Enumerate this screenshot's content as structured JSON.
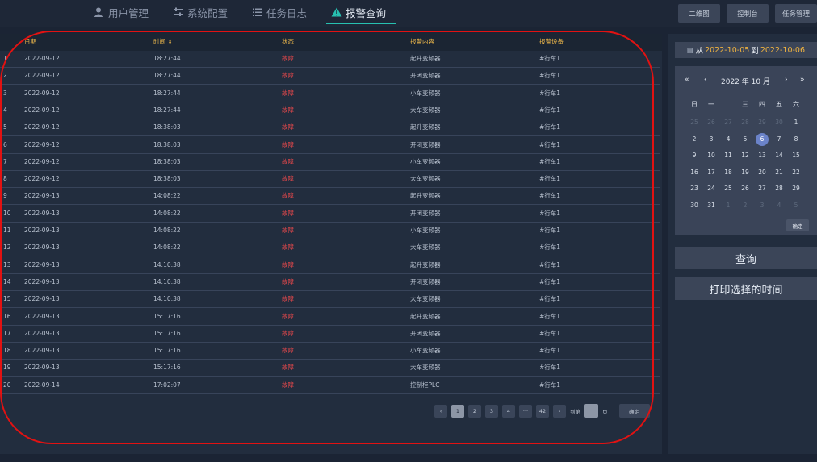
{
  "nav": {
    "items": [
      {
        "label": "用户管理",
        "icon": "user-icon"
      },
      {
        "label": "系统配置",
        "icon": "sliders-icon"
      },
      {
        "label": "任务日志",
        "icon": "list-icon"
      },
      {
        "label": "报警查询",
        "icon": "warning-icon"
      }
    ],
    "active": "报警查询"
  },
  "top_buttons": [
    "二维图",
    "控制台",
    "任务管理"
  ],
  "table": {
    "headers": [
      "日期",
      "时间 ⇕",
      "状态",
      "报警内容",
      "报警设备"
    ],
    "rows": [
      [
        "1",
        "2022-09-12",
        "18:27:44",
        "故障",
        "起升变频器",
        "#行车1"
      ],
      [
        "2",
        "2022-09-12",
        "18:27:44",
        "故障",
        "开闭变频器",
        "#行车1"
      ],
      [
        "3",
        "2022-09-12",
        "18:27:44",
        "故障",
        "小车变频器",
        "#行车1"
      ],
      [
        "4",
        "2022-09-12",
        "18:27:44",
        "故障",
        "大车变频器",
        "#行车1"
      ],
      [
        "5",
        "2022-09-12",
        "18:38:03",
        "故障",
        "起升变频器",
        "#行车1"
      ],
      [
        "6",
        "2022-09-12",
        "18:38:03",
        "故障",
        "开闭变频器",
        "#行车1"
      ],
      [
        "7",
        "2022-09-12",
        "18:38:03",
        "故障",
        "小车变频器",
        "#行车1"
      ],
      [
        "8",
        "2022-09-12",
        "18:38:03",
        "故障",
        "大车变频器",
        "#行车1"
      ],
      [
        "9",
        "2022-09-13",
        "14:08:22",
        "故障",
        "起升变频器",
        "#行车1"
      ],
      [
        "10",
        "2022-09-13",
        "14:08:22",
        "故障",
        "开闭变频器",
        "#行车1"
      ],
      [
        "11",
        "2022-09-13",
        "14:08:22",
        "故障",
        "小车变频器",
        "#行车1"
      ],
      [
        "12",
        "2022-09-13",
        "14:08:22",
        "故障",
        "大车变频器",
        "#行车1"
      ],
      [
        "13",
        "2022-09-13",
        "14:10:38",
        "故障",
        "起升变频器",
        "#行车1"
      ],
      [
        "14",
        "2022-09-13",
        "14:10:38",
        "故障",
        "开闭变频器",
        "#行车1"
      ],
      [
        "15",
        "2022-09-13",
        "14:10:38",
        "故障",
        "大车变频器",
        "#行车1"
      ],
      [
        "16",
        "2022-09-13",
        "15:17:16",
        "故障",
        "起升变频器",
        "#行车1"
      ],
      [
        "17",
        "2022-09-13",
        "15:17:16",
        "故障",
        "开闭变频器",
        "#行车1"
      ],
      [
        "18",
        "2022-09-13",
        "15:17:16",
        "故障",
        "小车变频器",
        "#行车1"
      ],
      [
        "19",
        "2022-09-13",
        "15:17:16",
        "故障",
        "大车变频器",
        "#行车1"
      ],
      [
        "20",
        "2022-09-14",
        "17:02:07",
        "故障",
        "控制柜PLC",
        "#行车1"
      ]
    ]
  },
  "pagination": {
    "prev": "‹",
    "pages": [
      "1",
      "2",
      "3",
      "4",
      "···",
      "42"
    ],
    "current": "1",
    "next": "›",
    "goto_prefix": "到第",
    "goto_suffix": "页",
    "confirm": "确定"
  },
  "date_range": {
    "prefix": "从",
    "start": "2022-10-05",
    "middle": "到",
    "end": "2022-10-06"
  },
  "calendar": {
    "title": "2022 年 10 月",
    "nav": [
      "«",
      "‹",
      "›",
      "»"
    ],
    "weekdays": [
      "日",
      "一",
      "二",
      "三",
      "四",
      "五",
      "六"
    ],
    "weeks": [
      [
        "25",
        "26",
        "27",
        "28",
        "29",
        "30",
        "1"
      ],
      [
        "2",
        "3",
        "4",
        "5",
        "6",
        "7",
        "8"
      ],
      [
        "9",
        "10",
        "11",
        "12",
        "13",
        "14",
        "15"
      ],
      [
        "16",
        "17",
        "18",
        "19",
        "20",
        "21",
        "22"
      ],
      [
        "23",
        "24",
        "25",
        "26",
        "27",
        "28",
        "29"
      ],
      [
        "30",
        "31",
        "1",
        "2",
        "3",
        "4",
        "5"
      ]
    ],
    "selected": "6",
    "confirm": "确定"
  },
  "actions": {
    "query": "查询",
    "print": "打印选择的时间"
  },
  "colors": {
    "accent": "#27c0b0",
    "header_text": "#e8b44a",
    "fault": "#e0474b",
    "highlight_date": "#f0b340",
    "annotation": "#e21212"
  }
}
